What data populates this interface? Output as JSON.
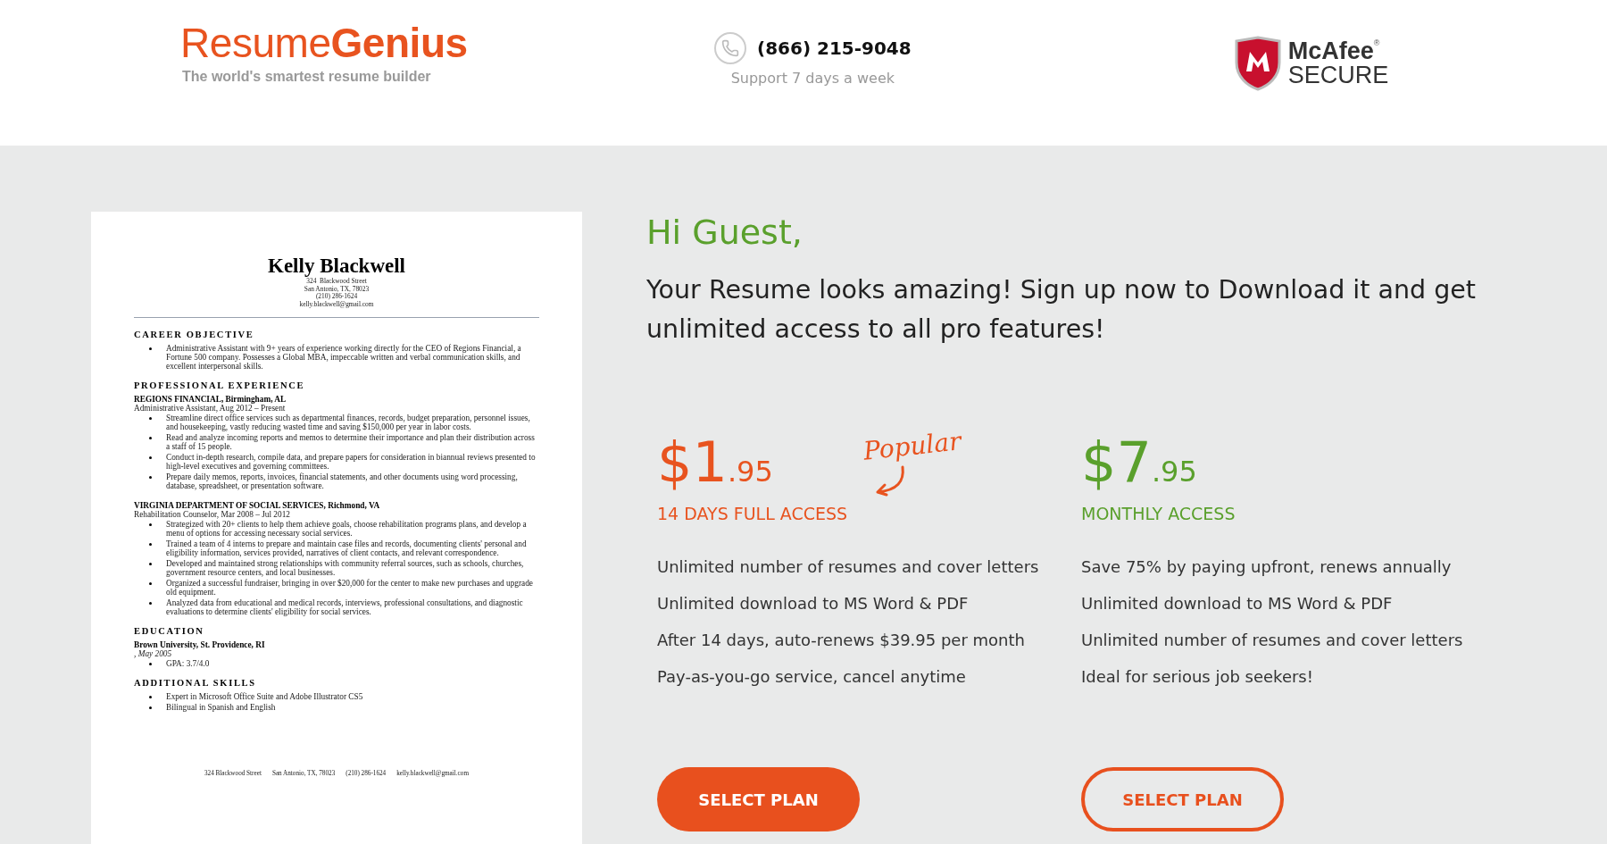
{
  "header": {
    "logo": {
      "light": "Resume",
      "bold": "Genius",
      "tagline": "The world's smartest resume builder"
    },
    "phone": {
      "number": "(866) 215-9048",
      "note": "Support 7 days a week"
    },
    "badge": {
      "brand": "McAfee",
      "mark": "®",
      "label": "SECURE"
    }
  },
  "resume": {
    "name": "Kelly Blackwell",
    "contact": [
      "324  Blackwood Street",
      "San Antonio, TX, 78023",
      "(210) 286-1624",
      "kelly.blackwell@gmail.com"
    ],
    "sections": [
      {
        "heading": "CAREER OBJECTIVE",
        "blocks": [
          {
            "bullets": [
              "Administrative Assistant with 9+ years of experience working directly for the CEO of Regions Financial, a Fortune 500 company. Possesses a Global MBA, impeccable written and verbal communication skills, and excellent interpersonal skills."
            ]
          }
        ]
      },
      {
        "heading": "PROFESSIONAL EXPERIENCE",
        "blocks": [
          {
            "org": "REGIONS FINANCIAL, Birmingham, AL",
            "role": "Administrative Assistant, Aug 2012 – Present",
            "bullets": [
              "Streamline direct office services such as departmental finances, records, budget preparation, personnel issues, and housekeeping, vastly reducing wasted time and saving $150,000 per year in labor costs.",
              "Read and analyze incoming reports and memos to determine their importance and plan their distribution across a staff of 15 people.",
              "Conduct in-depth research, compile data, and prepare papers for consideration in biannual reviews presented to high-level executives and governing committees.",
              "Prepare daily memos, reports, invoices, financial statements, and other documents using word processing, database, spreadsheet, or presentation software."
            ]
          },
          {
            "org": "VIRGINIA DEPARTMENT OF SOCIAL SERVICES, Richmond, VA",
            "role": "Rehabilitation Counselor, Mar 2008 – Jul 2012",
            "bullets": [
              "Strategized with 20+ clients to help them achieve goals, choose rehabilitation programs plans, and develop a menu of options for accessing necessary social services.",
              "Trained a team of 4 interns to prepare and maintain case files and records, documenting clients' personal and eligibility information, services provided, narratives of client contacts, and relevant correspondence.",
              "Developed and maintained strong relationships with community referral sources, such as schools, churches, government resource centers, and local businesses.",
              "Organized a successful fundraiser, bringing in over $20,000 for the center to make new purchases and upgrade old equipment.",
              "Analyzed data from educational and medical records, interviews, professional consultations, and diagnostic evaluations to determine clients' eligibility for social services."
            ]
          }
        ]
      },
      {
        "heading": "EDUCATION",
        "blocks": [
          {
            "org": "Brown University, St. Providence, RI",
            "date": ", May 2005",
            "bullets": [
              "GPA: 3.7/4.0"
            ]
          }
        ]
      },
      {
        "heading": "ADDITIONAL SKILLS",
        "blocks": [
          {
            "bullets": [
              "Expert in Microsoft Office Suite and Adobe Illustrator CS5",
              "Bilingual in Spanish and English"
            ]
          }
        ]
      }
    ],
    "footer": [
      "324 Blackwood Street",
      "San Antonio, TX, 78023",
      "(210) 286-1624",
      "kelly.blackwell@gmail.com"
    ]
  },
  "greeting": "Hi Guest,",
  "message": "Your Resume looks amazing! Sign up now to Download it and get unlimited access to all pro features!",
  "plans": [
    {
      "price": "$1",
      "cents": ".95",
      "title": "14 DAYS FULL ACCESS",
      "color": "#e8531f",
      "popular": "Popular",
      "features": [
        "Unlimited number of resumes and cover letters",
        "Unlimited download to MS Word & PDF",
        "After 14 days, auto-renews $39.95 per month",
        "Pay-as-you-go service, cancel anytime"
      ],
      "button": {
        "label": "SELECT PLAN",
        "kind": "filled"
      }
    },
    {
      "price": "$7",
      "cents": ".95",
      "title": "MONTHLY ACCESS",
      "color": "#5aa02c",
      "features": [
        "Save 75% by paying upfront, renews annually",
        "Unlimited download to MS Word & PDF",
        "Unlimited number of resumes and cover letters",
        "Ideal for serious job seekers!"
      ],
      "button": {
        "label": "SELECT PLAN",
        "kind": "outline"
      }
    }
  ]
}
